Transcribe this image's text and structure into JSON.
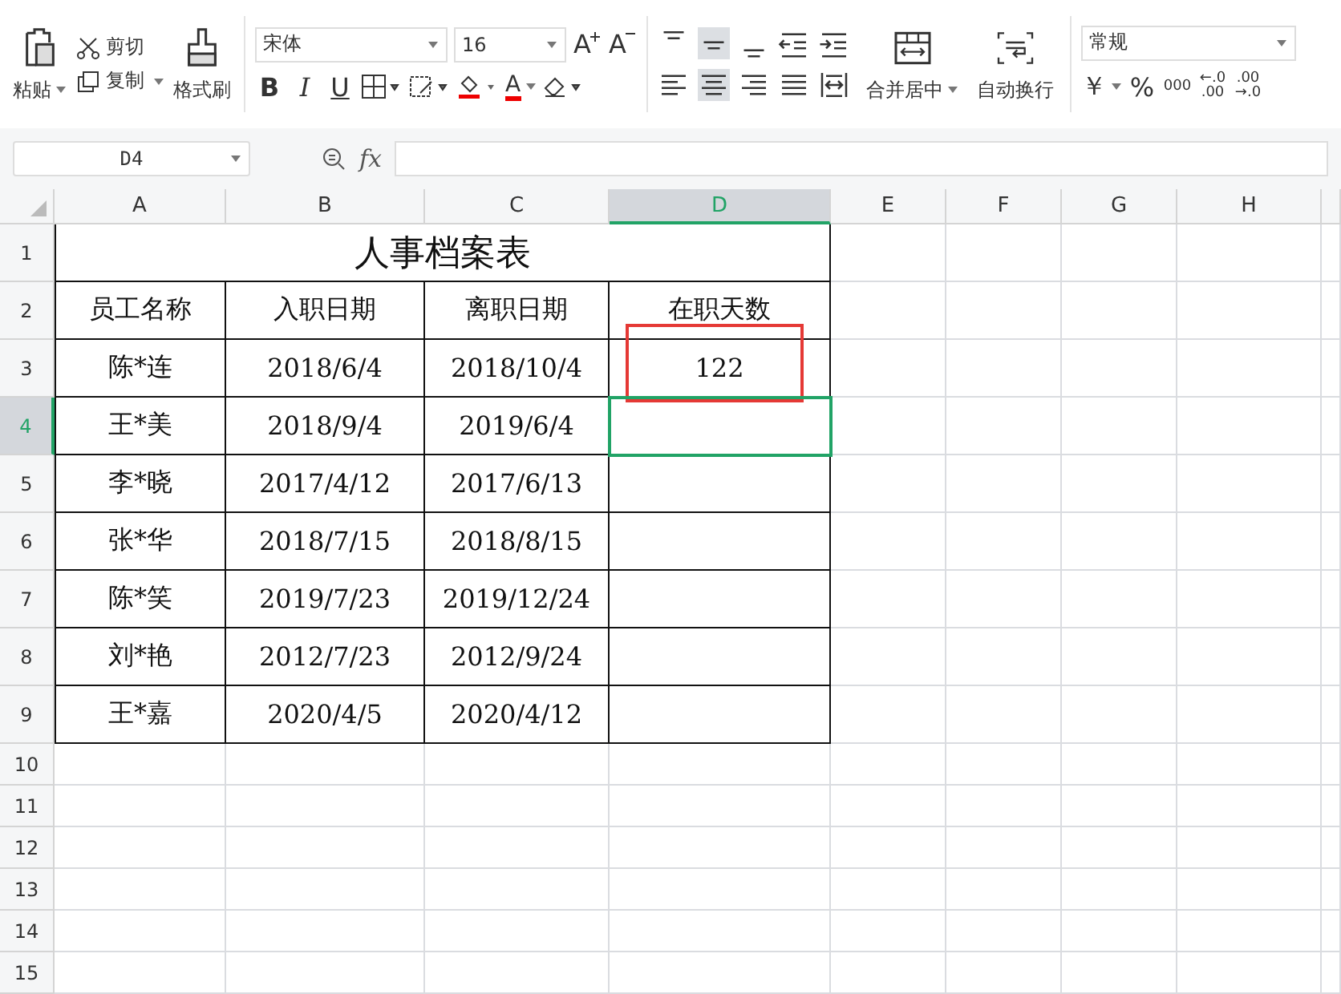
{
  "toolbar": {
    "paste": "粘贴",
    "cut": "剪切",
    "copy": "复制",
    "format_painter": "格式刷",
    "font_name": "宋体",
    "font_size": "16",
    "grow_font": "A",
    "shrink_font": "A",
    "style_buttons": [
      "B",
      "I",
      "U"
    ],
    "font_color": "A",
    "alignment": [
      {
        "kind": "top",
        "selected": false
      },
      {
        "kind": "middle",
        "selected": true
      },
      {
        "kind": "bottom",
        "selected": false
      },
      {
        "kind": "outdent",
        "selected": false
      },
      {
        "kind": "indent",
        "selected": false
      },
      {
        "kind": "left",
        "selected": false
      },
      {
        "kind": "center",
        "selected": true
      },
      {
        "kind": "right",
        "selected": false
      },
      {
        "kind": "justify",
        "selected": false
      },
      {
        "kind": "distributed",
        "selected": false
      }
    ],
    "merge": "合并居中",
    "wrap": "自动换行",
    "number_format": "常规",
    "currency": "￥",
    "percent": "%",
    "thousands": "000",
    "add_decimal": [
      "←.0",
      ".00"
    ],
    "remove_decimal": [
      ".00",
      "→.0"
    ]
  },
  "formula_bar": {
    "cell_ref": "D4",
    "fx": "fx"
  },
  "sheet": {
    "columns": [
      {
        "label": "A",
        "selected": false
      },
      {
        "label": "B",
        "selected": false
      },
      {
        "label": "C",
        "selected": false
      },
      {
        "label": "D",
        "selected": true
      },
      {
        "label": "E",
        "selected": false
      },
      {
        "label": "F",
        "selected": false
      },
      {
        "label": "G",
        "selected": false
      },
      {
        "label": "H",
        "selected": false
      }
    ],
    "row_headers": [
      {
        "label": "1",
        "selected": false
      },
      {
        "label": "2",
        "selected": false
      },
      {
        "label": "3",
        "selected": false
      },
      {
        "label": "4",
        "selected": true
      },
      {
        "label": "5",
        "selected": false
      },
      {
        "label": "6",
        "selected": false
      },
      {
        "label": "7",
        "selected": false
      },
      {
        "label": "8",
        "selected": false
      },
      {
        "label": "9",
        "selected": false
      },
      {
        "label": "10",
        "selected": false
      },
      {
        "label": "11",
        "selected": false
      },
      {
        "label": "12",
        "selected": false
      },
      {
        "label": "13",
        "selected": false
      },
      {
        "label": "14",
        "selected": false
      },
      {
        "label": "15",
        "selected": false
      }
    ],
    "title": "人事档案表",
    "header_cells": [
      "员工名称",
      "入职日期",
      "离职日期",
      "在职天数"
    ],
    "records": [
      {
        "cells": [
          {
            "text": "陈*连",
            "highlighted": false
          },
          {
            "text": "2018/6/4",
            "highlighted": false
          },
          {
            "text": "2018/10/4",
            "highlighted": false
          },
          {
            "text": "122",
            "highlighted": true
          }
        ]
      },
      {
        "cells": [
          {
            "text": "王*美",
            "highlighted": false
          },
          {
            "text": "2018/9/4",
            "highlighted": false
          },
          {
            "text": "2019/6/4",
            "highlighted": false
          }
        ]
      },
      {
        "cells": [
          {
            "text": "李*晓",
            "highlighted": false
          },
          {
            "text": "2017/4/12",
            "highlighted": false
          },
          {
            "text": "2017/6/13",
            "highlighted": false
          }
        ]
      },
      {
        "cells": [
          {
            "text": "张*华",
            "highlighted": false
          },
          {
            "text": "2018/7/15",
            "highlighted": false
          },
          {
            "text": "2018/8/15",
            "highlighted": false
          }
        ]
      },
      {
        "cells": [
          {
            "text": "陈*笑",
            "highlighted": false
          },
          {
            "text": "2019/7/23",
            "highlighted": false
          },
          {
            "text": "2019/12/24",
            "highlighted": false
          }
        ]
      },
      {
        "cells": [
          {
            "text": "刘*艳",
            "highlighted": false
          },
          {
            "text": "2012/7/23",
            "highlighted": false
          },
          {
            "text": "2012/9/24",
            "highlighted": false
          }
        ]
      },
      {
        "cells": [
          {
            "text": "王*嘉",
            "highlighted": false
          },
          {
            "text": "2020/4/5",
            "highlighted": false
          },
          {
            "text": "2020/4/12",
            "highlighted": false
          }
        ]
      }
    ]
  }
}
